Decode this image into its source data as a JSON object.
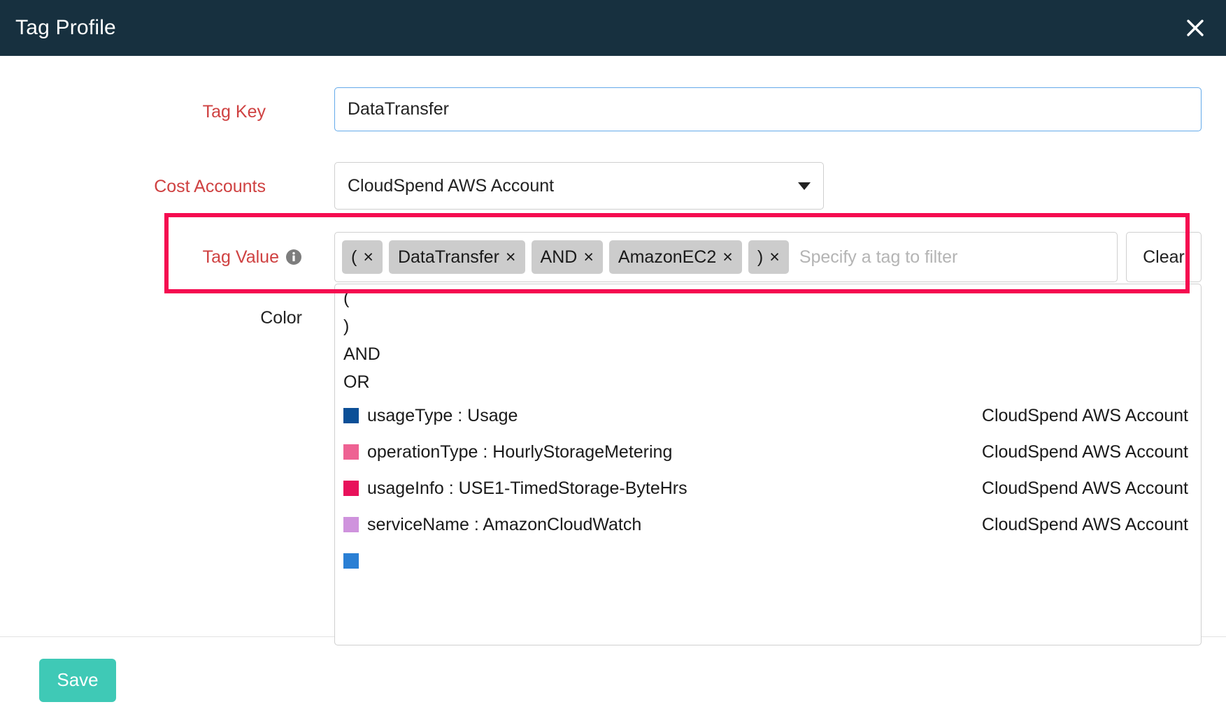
{
  "header": {
    "title": "Tag Profile",
    "close_icon": "close-icon"
  },
  "form": {
    "tag_key": {
      "label": "Tag Key",
      "value": "DataTransfer",
      "placeholder": ""
    },
    "cost_accounts": {
      "label": "Cost Accounts",
      "selected": "CloudSpend AWS Account",
      "caret_icon": "chevron-down-icon"
    },
    "tag_value": {
      "label": "Tag Value",
      "info_icon": "info-icon",
      "placeholder": "Specify a tag to filter",
      "value": "",
      "clear_label": "Clear",
      "chips": [
        {
          "text": "(",
          "remove": "×"
        },
        {
          "text": "DataTransfer",
          "remove": "×"
        },
        {
          "text": "AND",
          "remove": "×"
        },
        {
          "text": "AmazonEC2",
          "remove": "×"
        },
        {
          "text": ")",
          "remove": "×"
        }
      ]
    },
    "color": {
      "label": "Color"
    }
  },
  "dropdown": {
    "operators": [
      {
        "label": "("
      },
      {
        "label": ")"
      },
      {
        "label": "AND"
      },
      {
        "label": "OR"
      }
    ],
    "items": [
      {
        "label": "usageType : Usage",
        "account": "CloudSpend AWS Account",
        "color": "#0b4f97"
      },
      {
        "label": "operationType : HourlyStorageMetering",
        "account": "CloudSpend AWS Account",
        "color": "#ee6293"
      },
      {
        "label": "usageInfo : USE1-TimedStorage-ByteHrs",
        "account": "CloudSpend AWS Account",
        "color": "#e8115b"
      },
      {
        "label": "serviceName : AmazonCloudWatch",
        "account": "CloudSpend AWS Account",
        "color": "#cf93dd"
      },
      {
        "label": "",
        "account": "",
        "color": "#2a7fd4"
      }
    ]
  },
  "footer": {
    "save_label": "Save"
  },
  "colors": {
    "header_bg": "#17303f",
    "label_red": "#cf4141",
    "highlight": "#f50b50",
    "save_teal": "#3fc9b6",
    "focus_blue": "#64aaea"
  }
}
